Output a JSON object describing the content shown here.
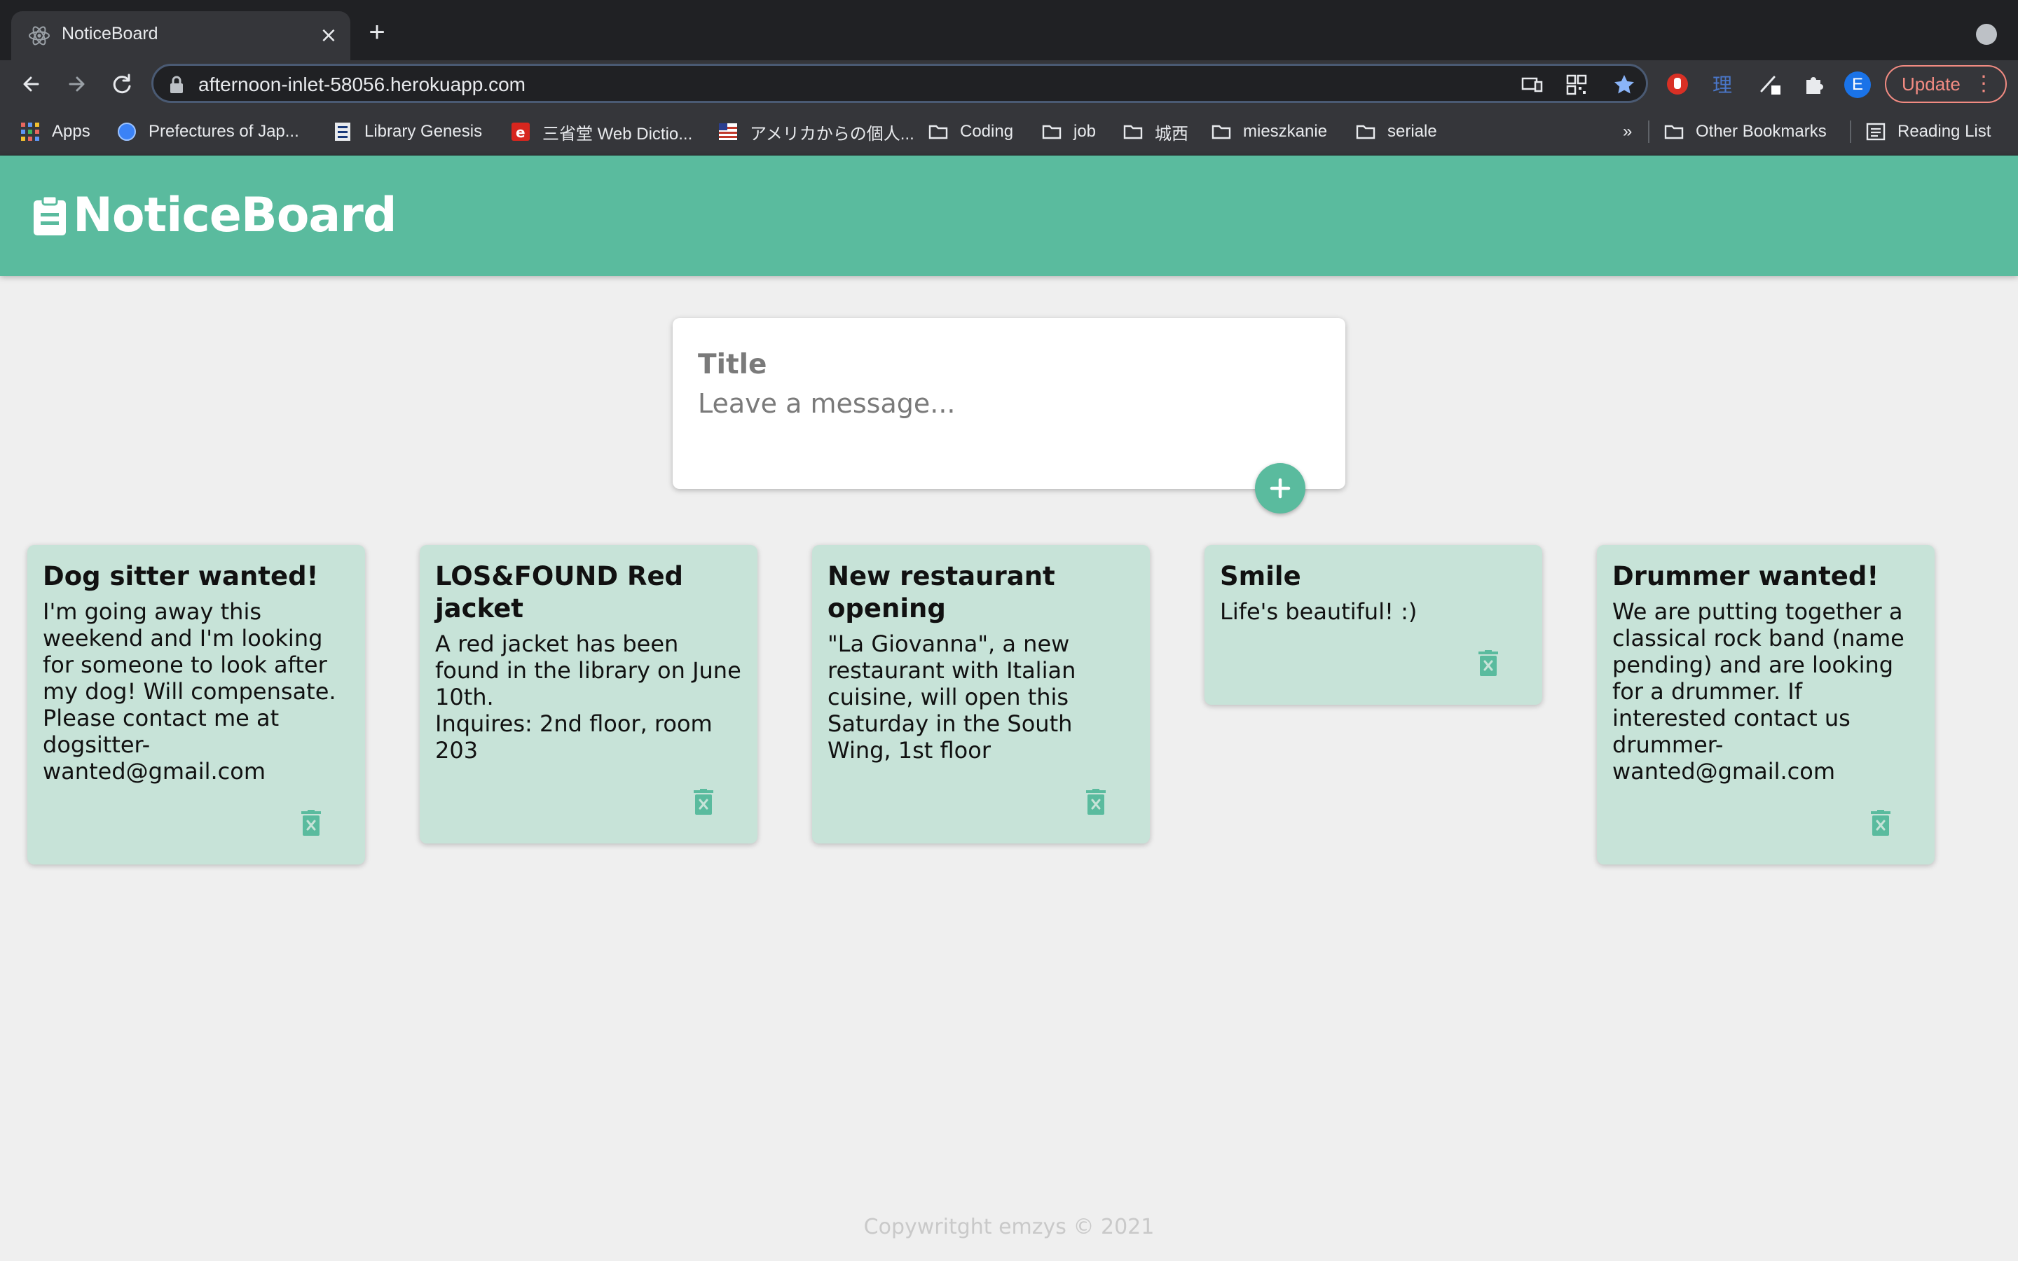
{
  "browser": {
    "tab": {
      "title": "NoticeBoard",
      "close_glyph": "×",
      "favicon": "react-icon"
    },
    "new_tab_glyph": "+",
    "url": "afternoon-inlet-58056.herokuapp.com",
    "profile_initial": "E",
    "update_label": "Update",
    "menu_glyph": "⋮",
    "bookmarks": [
      {
        "label": "Apps",
        "icon": "apps-grid-icon"
      },
      {
        "label": "Prefectures of Jap...",
        "icon": "globe-icon"
      },
      {
        "label": "Library Genesis",
        "icon": "book-icon"
      },
      {
        "label": "三省堂 Web Dictio...",
        "icon": "dictionary-icon"
      },
      {
        "label": "アメリカからの個人...",
        "icon": "flag-icon"
      },
      {
        "label": "Coding",
        "icon": "folder-icon"
      },
      {
        "label": "job",
        "icon": "folder-icon"
      },
      {
        "label": "城西",
        "icon": "folder-icon"
      },
      {
        "label": "mieszkanie",
        "icon": "folder-icon"
      },
      {
        "label": "seriale",
        "icon": "folder-icon"
      }
    ],
    "overflow_glyph": "»",
    "other_bookmarks": "Other Bookmarks",
    "reading_list": "Reading List"
  },
  "app": {
    "title": "NoticeBoard",
    "accent_color": "#5abb9e",
    "note_color": "#c7e3d8",
    "compose": {
      "title_placeholder": "Title",
      "message_placeholder": "Leave a message..."
    },
    "notes": [
      {
        "title": "Dog sitter wanted!",
        "body": "I'm going away this weekend and I'm looking for someone to look after my dog! Will compensate. Please contact me at dogsitter-wanted@gmail.com"
      },
      {
        "title": "LOS&FOUND Red jacket",
        "body": "A red jacket has been found in the library on June 10th.\nInquires: 2nd floor, room 203"
      },
      {
        "title": "New restaurant opening",
        "body": "\"La Giovanna\", a new restaurant with Italian cuisine, will open this Saturday in the South Wing, 1st floor"
      },
      {
        "title": "Smile",
        "body": "Life's beautiful! :)"
      },
      {
        "title": "Drummer wanted!",
        "body": "We are putting together a classical rock band (name pending) and are looking for a drummer. If interested contact us drummer-wanted@gmail.com"
      }
    ],
    "footer": "Copywritght emzys © 2021"
  }
}
